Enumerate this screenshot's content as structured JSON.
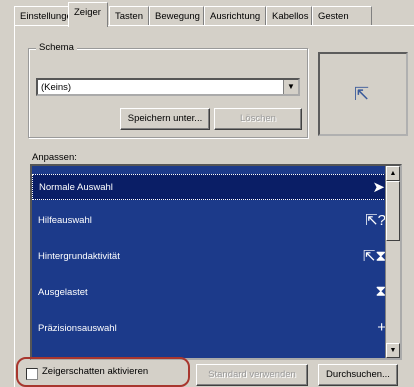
{
  "tabs": [
    {
      "label": "Einstellungen",
      "active": false
    },
    {
      "label": "Zeiger",
      "active": true
    },
    {
      "label": "Tasten",
      "active": false
    },
    {
      "label": "Bewegung",
      "active": false
    },
    {
      "label": "Ausrichtung",
      "active": false
    },
    {
      "label": "Kabellos",
      "active": false
    },
    {
      "label": "Gesten",
      "active": false
    }
  ],
  "scheme": {
    "legend": "Schema",
    "value": "(Keins)",
    "save_as_label": "Speichern unter...",
    "delete_label": "Löschen"
  },
  "customize": {
    "legend": "Anpassen:",
    "items": [
      {
        "label": "Normale Auswahl",
        "icon": "arrow-cursor-icon",
        "glyph": "➤",
        "selected": true
      },
      {
        "label": "Hilfeauswahl",
        "icon": "help-cursor-icon",
        "glyph": "⇱?",
        "selected": false
      },
      {
        "label": "Hintergrundaktivität",
        "icon": "busy-background-cursor-icon",
        "glyph": "⇱⧗",
        "selected": false
      },
      {
        "label": "Ausgelastet",
        "icon": "hourglass-cursor-icon",
        "glyph": "⧗",
        "selected": false
      },
      {
        "label": "Präzisionsauswahl",
        "icon": "crosshair-cursor-icon",
        "glyph": "+",
        "selected": false
      }
    ]
  },
  "shadow_checkbox_label": "Zeigerschatten aktivieren",
  "default_button_label": "Standard verwenden",
  "browse_button_label": "Durchsuchen..."
}
